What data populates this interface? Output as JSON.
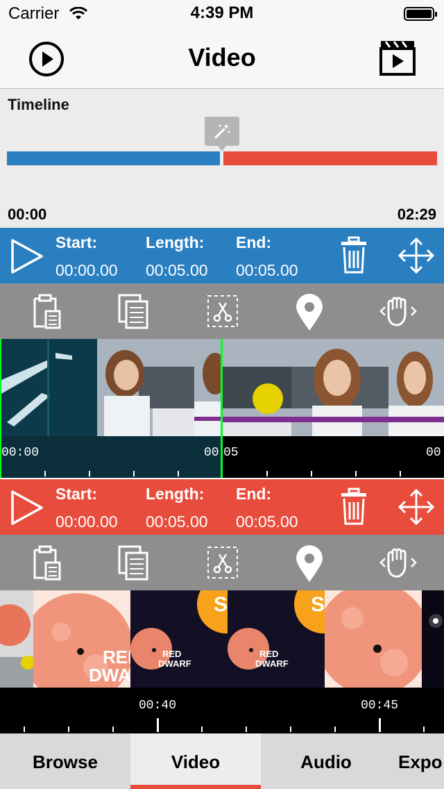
{
  "status_bar": {
    "carrier": "Carrier",
    "time": "4:39 PM"
  },
  "nav": {
    "title": "Video"
  },
  "timeline": {
    "label": "Timeline",
    "start_time": "00:00",
    "end_time": "02:29"
  },
  "clips": [
    {
      "color": "#2a7fc1",
      "start_label": "Start:",
      "start_value": "00:00.00",
      "length_label": "Length:",
      "length_value": "00:05.00",
      "end_label": "End:",
      "end_value": "00:05.00",
      "ruler_labels": [
        "00:00",
        "00",
        "05",
        "00"
      ]
    },
    {
      "color": "#e84c3d",
      "start_label": "Start:",
      "start_value": "00:00.00",
      "length_label": "Length:",
      "length_value": "00:05.00",
      "end_label": "End:",
      "end_value": "00:05.00",
      "ruler_labels": [
        "00:40",
        "00:45"
      ],
      "thumb_texts": [
        "REI",
        "DWA",
        "RED",
        "DWARF",
        "S"
      ]
    }
  ],
  "tabs": [
    "Browse",
    "Video",
    "Audio",
    "Expo"
  ],
  "active_tab": "Video",
  "colors": {
    "blue": "#2a7fc1",
    "red": "#e84c3d",
    "toolbar": "#8e8e8e"
  },
  "icons": [
    "play-circle-icon",
    "film-clapper-icon",
    "magic-wand-icon",
    "play-icon",
    "trash-icon",
    "move-arrows-icon",
    "clipboard-paste-icon",
    "copy-icon",
    "scissors-icon",
    "location-pin-icon",
    "hand-grab-icon"
  ]
}
